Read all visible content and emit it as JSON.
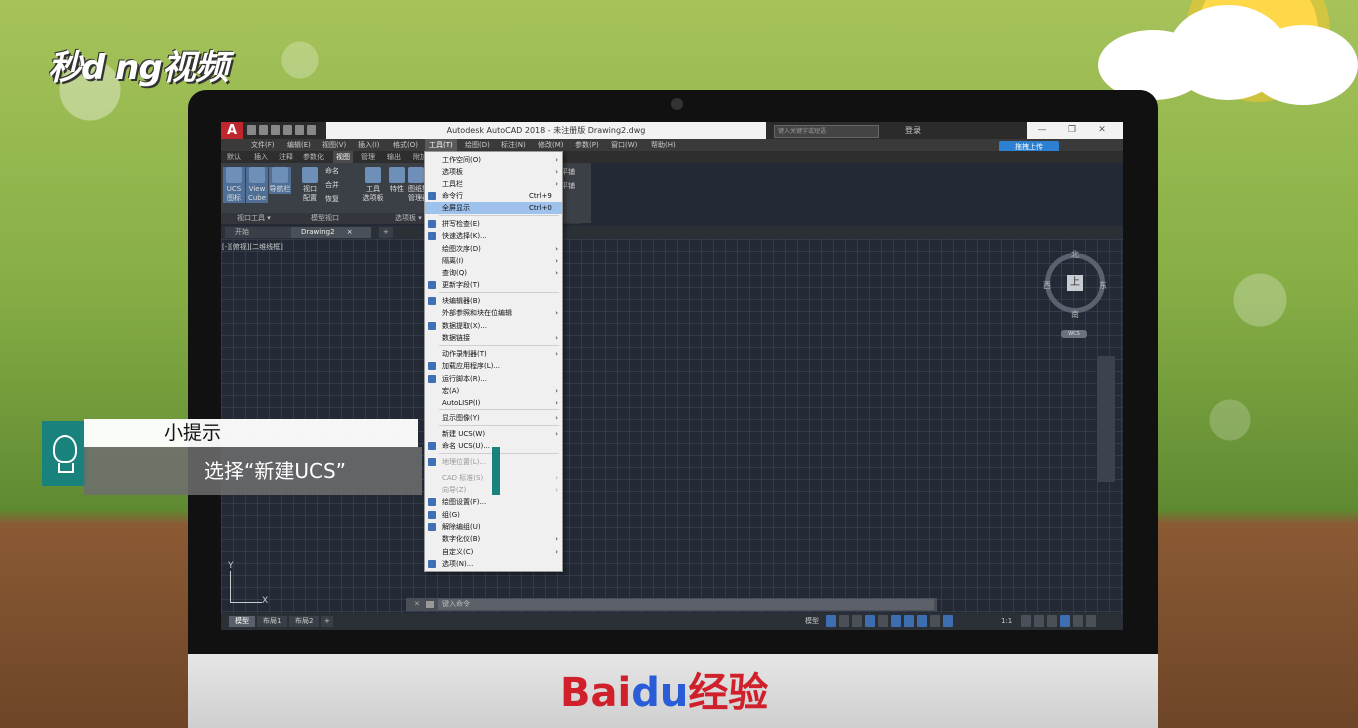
{
  "watermark": {
    "logo": "秒d ng视频"
  },
  "brand": {
    "baidu": "Bai",
    "du": "du",
    "jingyan": "经验"
  },
  "titlebar": {
    "app_icon": "A",
    "title": "Autodesk AutoCAD 2018 - 未注册版    Drawing2.dwg",
    "search_placeholder": "键入关键字或短语",
    "login": "登录",
    "minimize": "—",
    "restore": "❐",
    "close": "✕"
  },
  "menubar": {
    "items": [
      "文件(F)",
      "编辑(E)",
      "视图(V)",
      "插入(I)",
      "格式(O)",
      "工具(T)",
      "绘图(D)",
      "标注(N)",
      "修改(M)",
      "参数(P)",
      "窗口(W)",
      "帮助(H)"
    ]
  },
  "ribbon_tabs": {
    "items": [
      "默认",
      "插入",
      "注释",
      "参数化",
      "视图",
      "管理",
      "输出",
      "附加"
    ]
  },
  "share_button": "拖拽上传",
  "ribbon": {
    "buttons": [
      {
        "label": "UCS\n图标"
      },
      {
        "label": "View\nCube"
      },
      {
        "label": "导航栏"
      },
      {
        "label": "视口\n配置"
      },
      {
        "label": "命名"
      },
      {
        "label": "合并"
      },
      {
        "label": "恢复"
      },
      {
        "label": "工具\n选项板"
      },
      {
        "label": "特性"
      },
      {
        "label": "图纸集\n管理器"
      }
    ],
    "panels": [
      "视口工具 ▾",
      "模型视口",
      "选项板 ▾"
    ],
    "right_labels": [
      "平铺",
      "平铺"
    ]
  },
  "doc_tabs": {
    "start": "开始",
    "drawing": "Drawing2",
    "close": "×",
    "add": "+"
  },
  "viewport": {
    "label": "[-][俯视][二维线框]",
    "viewcube": {
      "north": "北",
      "south": "南",
      "east": "东",
      "west": "西",
      "top": "上",
      "wcs": "WCS"
    },
    "ucs": {
      "x": "X",
      "y": "Y"
    }
  },
  "cmdline": {
    "close": "✕",
    "placeholder": "键入命令"
  },
  "status": {
    "layouts": [
      "模型",
      "布局1",
      "布局2",
      "+"
    ],
    "model": "模型",
    "scale": "1:1"
  },
  "tools_menu": {
    "items": [
      {
        "label": "工作空间(O)",
        "shortcut": "",
        "submenu": true,
        "icon": false,
        "highlight": false,
        "disabled": false
      },
      {
        "label": "选项板",
        "shortcut": "",
        "submenu": true,
        "icon": false,
        "highlight": false,
        "disabled": false
      },
      {
        "label": "工具栏",
        "shortcut": "",
        "submenu": true,
        "icon": false,
        "highlight": false,
        "disabled": false
      },
      {
        "label": "命令行",
        "shortcut": "Ctrl+9",
        "submenu": false,
        "icon": true,
        "highlight": false,
        "disabled": false
      },
      {
        "label": "全屏显示",
        "shortcut": "Ctrl+0",
        "submenu": false,
        "icon": false,
        "highlight": true,
        "disabled": false
      },
      {
        "label": "拼写检查(E)",
        "shortcut": "",
        "submenu": false,
        "icon": true,
        "highlight": false,
        "disabled": false
      },
      {
        "label": "快速选择(K)...",
        "shortcut": "",
        "submenu": false,
        "icon": true,
        "highlight": false,
        "disabled": false
      },
      {
        "label": "绘图次序(D)",
        "shortcut": "",
        "submenu": true,
        "icon": false,
        "highlight": false,
        "disabled": false
      },
      {
        "label": "隔离(I)",
        "shortcut": "",
        "submenu": true,
        "icon": false,
        "highlight": false,
        "disabled": false
      },
      {
        "label": "查询(Q)",
        "shortcut": "",
        "submenu": true,
        "icon": false,
        "highlight": false,
        "disabled": false
      },
      {
        "label": "更新字段(T)",
        "shortcut": "",
        "submenu": false,
        "icon": true,
        "highlight": false,
        "disabled": false
      },
      {
        "label": "块编辑器(B)",
        "shortcut": "",
        "submenu": false,
        "icon": true,
        "highlight": false,
        "disabled": false
      },
      {
        "label": "外部参照和块在位编辑",
        "shortcut": "",
        "submenu": true,
        "icon": false,
        "highlight": false,
        "disabled": false
      },
      {
        "label": "数据提取(X)...",
        "shortcut": "",
        "submenu": false,
        "icon": true,
        "highlight": false,
        "disabled": false
      },
      {
        "label": "数据链接",
        "shortcut": "",
        "submenu": true,
        "icon": false,
        "highlight": false,
        "disabled": false
      },
      {
        "label": "动作录制器(T)",
        "shortcut": "",
        "submenu": true,
        "icon": false,
        "highlight": false,
        "disabled": false
      },
      {
        "label": "加载应用程序(L)...",
        "shortcut": "",
        "submenu": false,
        "icon": true,
        "highlight": false,
        "disabled": false
      },
      {
        "label": "运行脚本(R)...",
        "shortcut": "",
        "submenu": false,
        "icon": true,
        "highlight": false,
        "disabled": false
      },
      {
        "label": "宏(A)",
        "shortcut": "",
        "submenu": true,
        "icon": false,
        "highlight": false,
        "disabled": false
      },
      {
        "label": "AutoLISP(I)",
        "shortcut": "",
        "submenu": true,
        "icon": false,
        "highlight": false,
        "disabled": false
      },
      {
        "label": "显示图像(Y)",
        "shortcut": "",
        "submenu": true,
        "icon": false,
        "highlight": false,
        "disabled": false
      },
      {
        "label": "新建 UCS(W)",
        "shortcut": "",
        "submenu": true,
        "icon": false,
        "highlight": false,
        "disabled": false
      },
      {
        "label": "命名 UCS(U)...",
        "shortcut": "",
        "submenu": false,
        "icon": true,
        "highlight": false,
        "disabled": false
      },
      {
        "label": "地理位置(L)...",
        "shortcut": "",
        "submenu": false,
        "icon": true,
        "highlight": false,
        "disabled": true
      },
      {
        "label": "CAD 标准(S)",
        "shortcut": "",
        "submenu": true,
        "icon": false,
        "highlight": false,
        "disabled": true
      },
      {
        "label": "向导(Z)",
        "shortcut": "",
        "submenu": true,
        "icon": false,
        "highlight": false,
        "disabled": true
      },
      {
        "label": "绘图设置(F)...",
        "shortcut": "",
        "submenu": false,
        "icon": true,
        "highlight": false,
        "disabled": false
      },
      {
        "label": "组(G)",
        "shortcut": "",
        "submenu": false,
        "icon": true,
        "highlight": false,
        "disabled": false
      },
      {
        "label": "解除编组(U)",
        "shortcut": "",
        "submenu": false,
        "icon": true,
        "highlight": false,
        "disabled": false
      },
      {
        "label": "数字化仪(B)",
        "shortcut": "",
        "submenu": true,
        "icon": false,
        "highlight": false,
        "disabled": false
      },
      {
        "label": "自定义(C)",
        "shortcut": "",
        "submenu": true,
        "icon": false,
        "highlight": false,
        "disabled": false
      },
      {
        "label": "选项(N)...",
        "shortcut": "",
        "submenu": false,
        "icon": true,
        "highlight": false,
        "disabled": false
      }
    ]
  },
  "tip": {
    "title": "小提示",
    "body": "选择“新建UCS”"
  }
}
